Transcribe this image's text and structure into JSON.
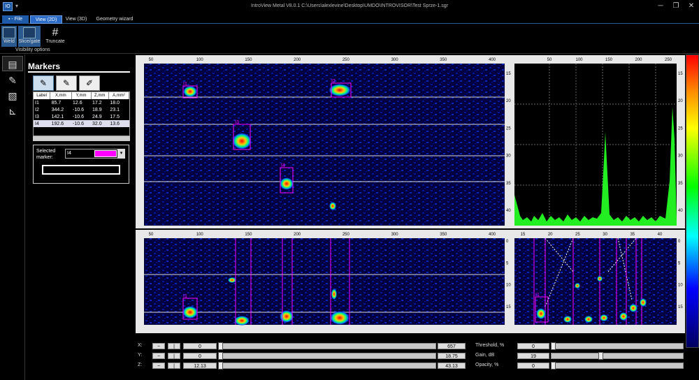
{
  "window": {
    "app_icon": "IO",
    "qa_icon": "▾",
    "title": "IntroView Metal V8.0.1    C:\\Users\\alexlevine\\Desktop\\UMDO\\INTROVISOR\\Test Sprze-1.sgr",
    "min": "─",
    "max": "❐",
    "close": "✕"
  },
  "tabs": {
    "file": "▪ - File",
    "view2d": "View (2D)",
    "view3d": "View (3D)",
    "geometry": "Geometry wizard"
  },
  "ribbon": {
    "weld": "Weld",
    "slice": "Slice/gate",
    "truncate": "Truncate",
    "group": "Visibility options"
  },
  "left_icons": [
    "document-icon",
    "pen-icon",
    "layers-icon",
    "ruler-icon"
  ],
  "markers": {
    "title": "Markers",
    "tools": [
      "✎",
      "✎",
      "✐"
    ],
    "columns": [
      "Label",
      "X,mm",
      "Y,mm",
      "Z,mm",
      "A,mm²"
    ],
    "rows": [
      {
        "label": "I1",
        "x": "85.7",
        "y": "12.6",
        "z": "17.2",
        "a": "18.0"
      },
      {
        "label": "I2",
        "x": "344.2",
        "y": "-10.6",
        "z": "18.9",
        "a": "23.1"
      },
      {
        "label": "I3",
        "x": "142.1",
        "y": "-10.6",
        "z": "24.9",
        "a": "17.5"
      },
      {
        "label": "I4",
        "x": "192.6",
        "y": "-10.6",
        "z": "32.0",
        "a": "13.6"
      }
    ],
    "selected_label": "Selected marker:",
    "selected_value": "I4",
    "selected_color": "#ff00ff"
  },
  "views": {
    "cscan": {
      "x_ticks": [
        "50",
        "100",
        "150",
        "200",
        "250",
        "300",
        "350",
        "400"
      ],
      "y_ticks": [
        "15",
        "20",
        "25",
        "30",
        "35",
        "40"
      ],
      "markers": [
        "I1",
        "I2",
        "I3",
        "I4"
      ]
    },
    "bscan": {
      "x_ticks": [
        "50",
        "100",
        "150",
        "200",
        "250",
        "300",
        "350",
        "400"
      ],
      "y_ticks": [
        "0",
        "5",
        "10",
        "15"
      ],
      "markers": [
        "I1"
      ]
    },
    "ascan": {
      "x_ticks": [
        "50",
        "100",
        "150",
        "200",
        "250"
      ],
      "y_ticks": [
        "15",
        "20",
        "25",
        "30",
        "35",
        "40"
      ]
    },
    "dscan": {
      "x_ticks": [
        "15",
        "20",
        "25",
        "30",
        "35",
        "40"
      ],
      "y_ticks": [
        "0",
        "5",
        "10",
        "15"
      ],
      "markers": [
        "I1"
      ]
    }
  },
  "controls": {
    "axes": [
      {
        "label": "X:",
        "value": "0",
        "end": "657",
        "position": 0.0
      },
      {
        "label": "Y:",
        "value": "0",
        "end": "18.75",
        "position": 0.0
      },
      {
        "label": "Z:",
        "value": "12.13",
        "end": "43.13",
        "position": 0.0
      }
    ],
    "params": [
      {
        "label": "Threshold, %",
        "value": "0",
        "position": 0.0
      },
      {
        "label": "Gain, dB",
        "value": "19",
        "position": 0.38
      },
      {
        "label": "Opacity, %",
        "value": "0",
        "position": 0.0
      }
    ]
  }
}
